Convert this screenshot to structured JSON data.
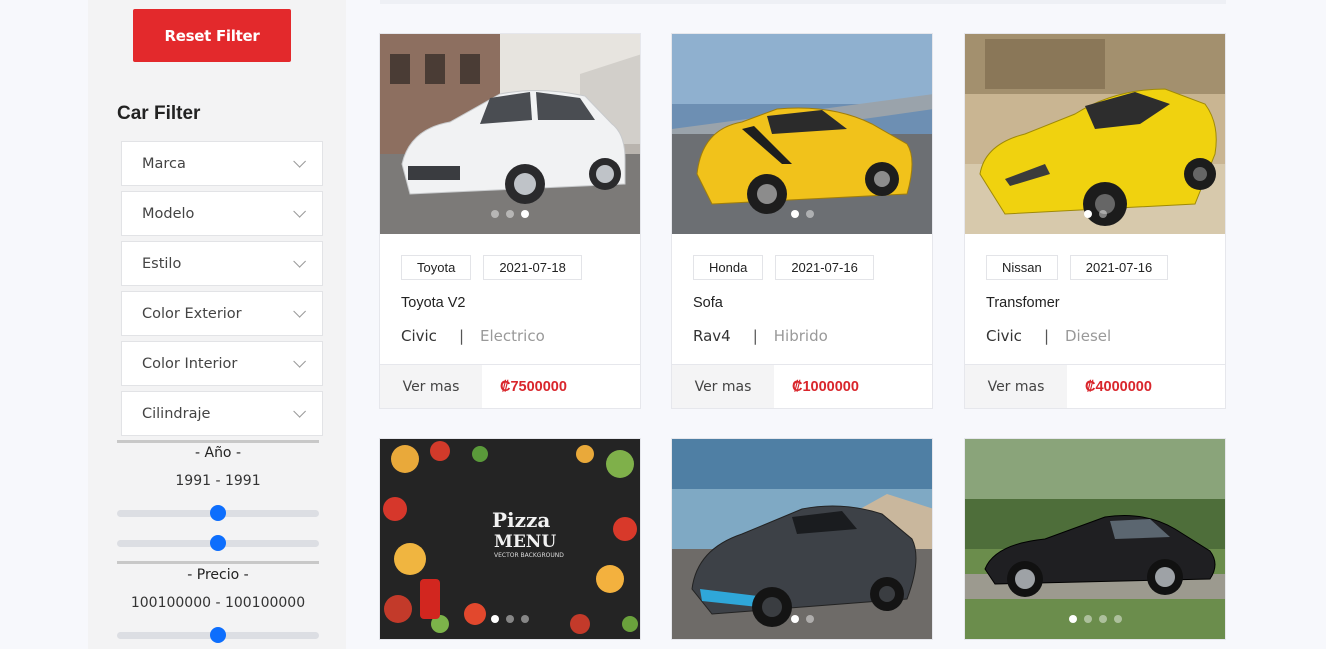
{
  "sidebar": {
    "reset_label": "Reset Filter",
    "title": "Car Filter",
    "selects": [
      "Marca",
      "Modelo",
      "Estilo",
      "Color Exterior",
      "Color Interior",
      "Cilindraje"
    ],
    "year": {
      "title": "- Año -",
      "value": "1991 - 1991",
      "min_level": 0.5,
      "max_level": 0.5
    },
    "price": {
      "title": "- Precio -",
      "value": "100100000 - 100100000",
      "level": 0.5
    }
  },
  "cards": [
    {
      "brand": "Toyota",
      "date": "2021-07-18",
      "title": "Toyota V2",
      "model": "Civic",
      "fuel": "Electrico",
      "more": "Ver mas",
      "price": "₡7500000",
      "image": "white-sedan",
      "dots": 3,
      "active_dot": 3
    },
    {
      "brand": "Honda",
      "date": "2021-07-16",
      "title": "Sofa",
      "model": "Rav4",
      "fuel": "Hibrido",
      "more": "Ver mas",
      "price": "₡1000000",
      "image": "yellow-mustang",
      "dots": 2,
      "active_dot": 1
    },
    {
      "brand": "Nissan",
      "date": "2021-07-16",
      "title": "Transfomer",
      "model": "Civic",
      "fuel": "Diesel",
      "more": "Ver mas",
      "price": "₡4000000",
      "image": "yellow-corvette",
      "dots": 2,
      "active_dot": 1
    },
    {
      "image": "pizza-menu",
      "dots": 3,
      "active_dot": 1,
      "image_text": [
        "Pizza",
        "MENU",
        "VECTOR BACKGROUND"
      ]
    },
    {
      "image": "dark-hypercar",
      "dots": 2,
      "active_dot": 1
    },
    {
      "image": "black-coupe",
      "dots": 4,
      "active_dot": 1
    }
  ]
}
